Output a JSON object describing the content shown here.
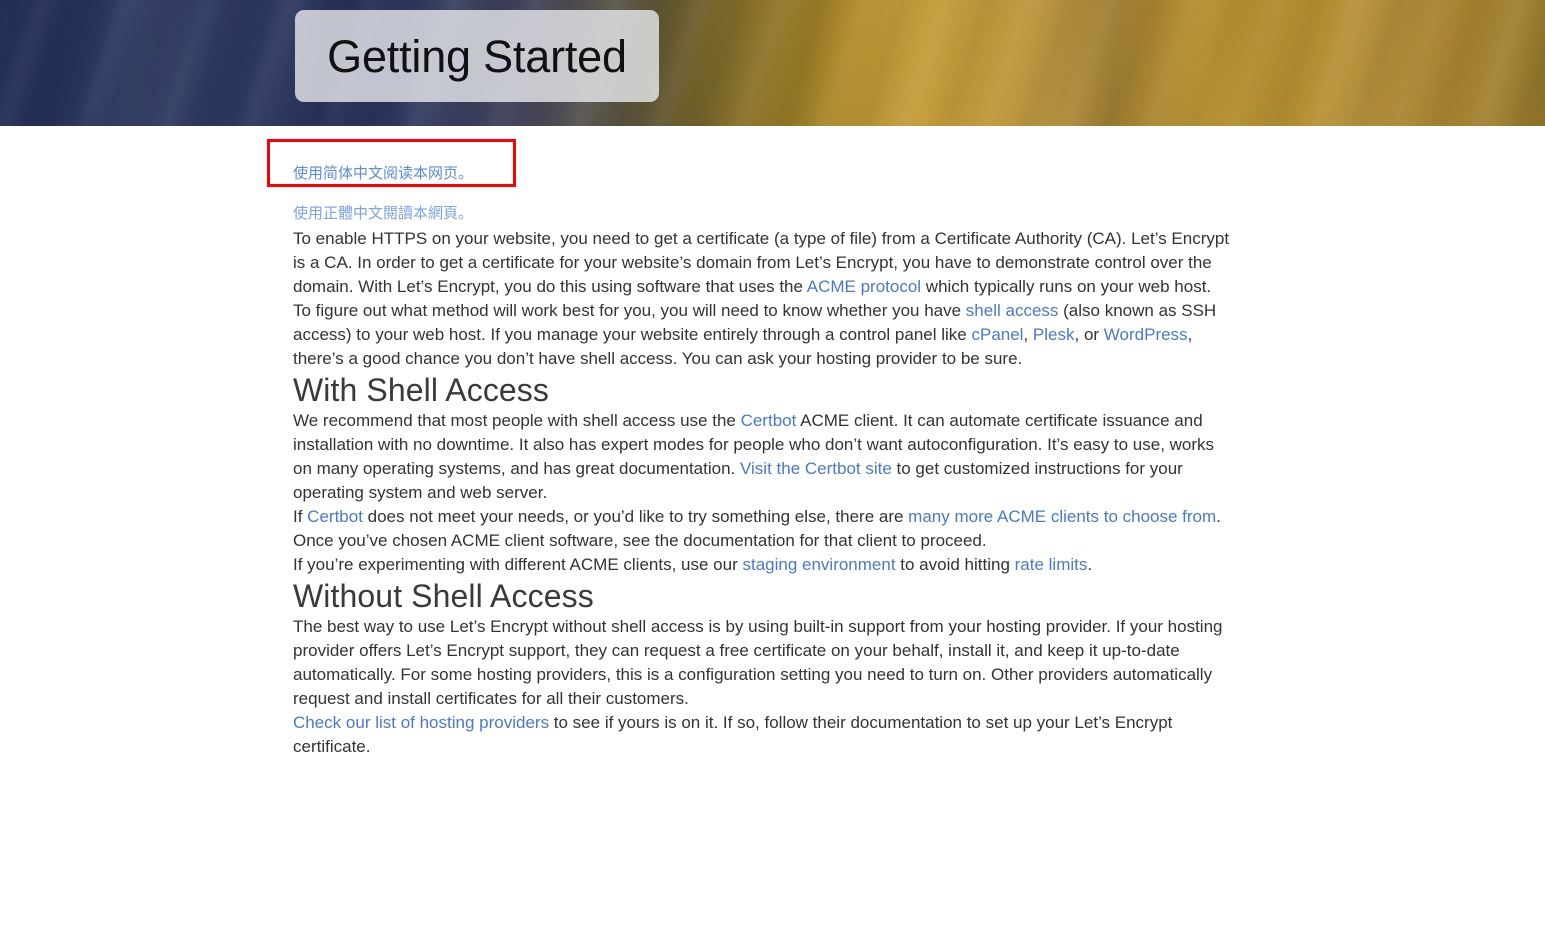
{
  "banner": {
    "title": "Getting Started",
    "gradient_start": "#202c56",
    "gradient_end": "#9a7a2b",
    "title_box_color": "#e8eaee"
  },
  "highlight": {
    "border_color": "#fe0000"
  },
  "language_links": {
    "simplified_chinese": "使用简体中文阅读本网页。",
    "traditional_chinese": "使用正體中文閱讀本網頁。"
  },
  "link_color": "#4a78cf",
  "intro": {
    "p1_a": "To enable HTTPS on your website, you need to get a certificate (a type of file) from a Certificate Authority (CA). Let’s Encrypt is a CA. In order to get a certificate for your website’s domain from Let’s Encrypt, you have to demonstrate control over the domain. With Let’s Encrypt, you do this using software that uses the ",
    "p1_link": "ACME protocol",
    "p1_b": " which typically runs on your web host.",
    "p2_a": "To figure out what method will work best for you, you will need to know whether you have ",
    "p2_link1": "shell access",
    "p2_b": " (also known as SSH access) to your web host. If you manage your website entirely through a control panel like ",
    "p2_link2": "cPanel",
    "p2_c": ", ",
    "p2_link3": "Plesk",
    "p2_d": ", or ",
    "p2_link4": "WordPress",
    "p2_e": ", there’s a good chance you don’t have shell access. You can ask your hosting provider to be sure."
  },
  "with_shell": {
    "heading": "With Shell Access",
    "p1_a": "We recommend that most people with shell access use the ",
    "p1_link1": "Certbot",
    "p1_b": " ACME client. It can automate certificate issuance and installation with no downtime. It also has expert modes for people who don’t want autoconfiguration. It’s easy to use, works on many operating systems, and has great documentation. ",
    "p1_link2": "Visit the Certbot site",
    "p1_c": " to get customized instructions for your operating system and web server.",
    "p2_a": "If ",
    "p2_link1": "Certbot",
    "p2_b": " does not meet your needs, or you’d like to try something else, there are ",
    "p2_link2": "many more ACME clients to choose from",
    "p2_c": ". Once you’ve chosen ACME client software, see the documentation for that client to proceed.",
    "p3_a": "If you’re experimenting with different ACME clients, use our ",
    "p3_link1": "staging environment",
    "p3_b": " to avoid hitting ",
    "p3_link2": "rate limits",
    "p3_c": "."
  },
  "without_shell": {
    "heading": "Without Shell Access",
    "p1": "The best way to use Let’s Encrypt without shell access is by using built-in support from your hosting provider. If your hosting provider offers Let’s Encrypt support, they can request a free certificate on your behalf, install it, and keep it up-to-date automatically. For some hosting providers, this is a configuration setting you need to turn on. Other providers automatically request and install certificates for all their customers.",
    "p2_link": "Check our list of hosting providers",
    "p2_a": " to see if yours is on it. If so, follow their documentation to set up your Let’s Encrypt certificate."
  }
}
